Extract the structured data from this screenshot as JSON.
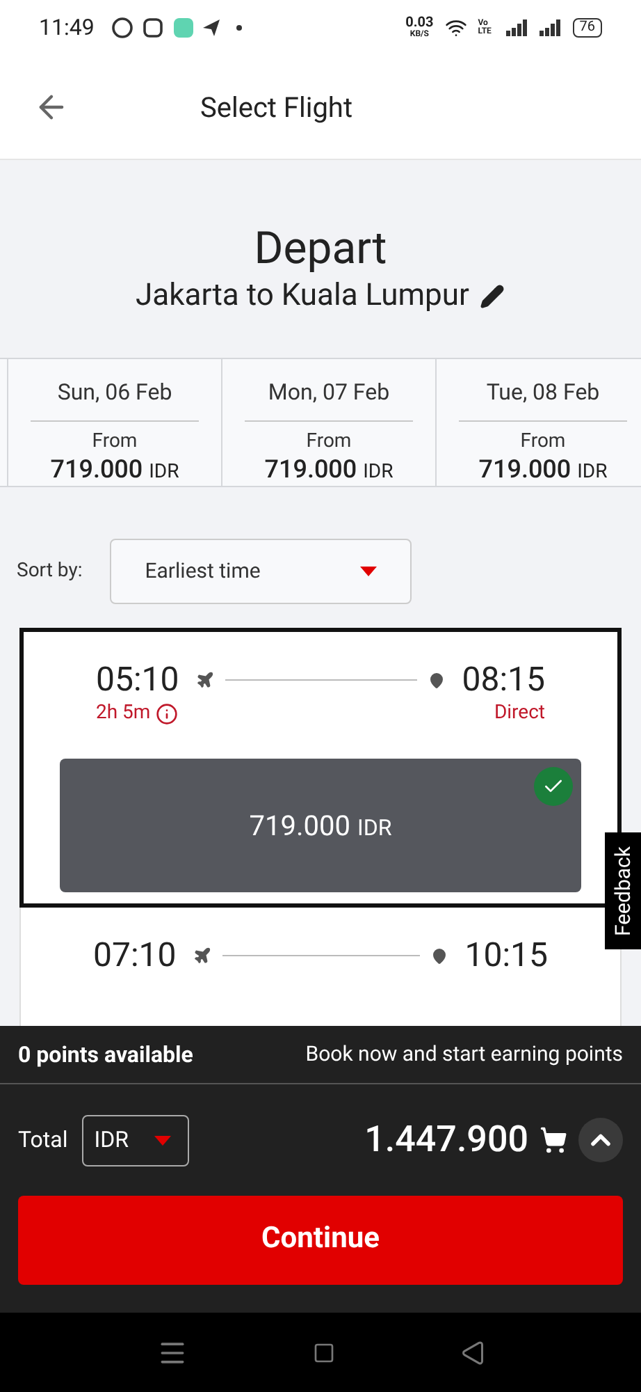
{
  "status_bar": {
    "time": "11:49",
    "speed": "0.03",
    "speed_unit": "KB/S",
    "network": "Vo LTE",
    "battery": "76"
  },
  "header": {
    "title": "Select Flight"
  },
  "journey": {
    "title": "Depart",
    "route": "Jakarta to Kuala Lumpur"
  },
  "dates": [
    {
      "date": "Sun, 06 Feb",
      "from": "From",
      "price": "719.000",
      "currency": "IDR",
      "selected": false
    },
    {
      "date": "Mon, 07 Feb",
      "from": "From",
      "price": "719.000",
      "currency": "IDR",
      "selected": false
    },
    {
      "date": "Tue, 08 Feb",
      "from": "From",
      "price": "719.000",
      "currency": "IDR",
      "selected": false
    }
  ],
  "sort": {
    "label": "Sort by:",
    "value": "Earliest time"
  },
  "flights": [
    {
      "depart": "05:10",
      "arrive": "08:15",
      "duration": "2h 5m",
      "stops": "Direct",
      "price": "719.000",
      "currency": "IDR",
      "selected": true
    },
    {
      "depart": "07:10",
      "arrive": "10:15",
      "selected": false
    }
  ],
  "feedback": "Feedback",
  "points": {
    "available": "0 points available",
    "promo": "Book now and start earning points"
  },
  "total": {
    "label": "Total",
    "currency": "IDR",
    "amount": "1.447.900"
  },
  "continue": "Continue"
}
